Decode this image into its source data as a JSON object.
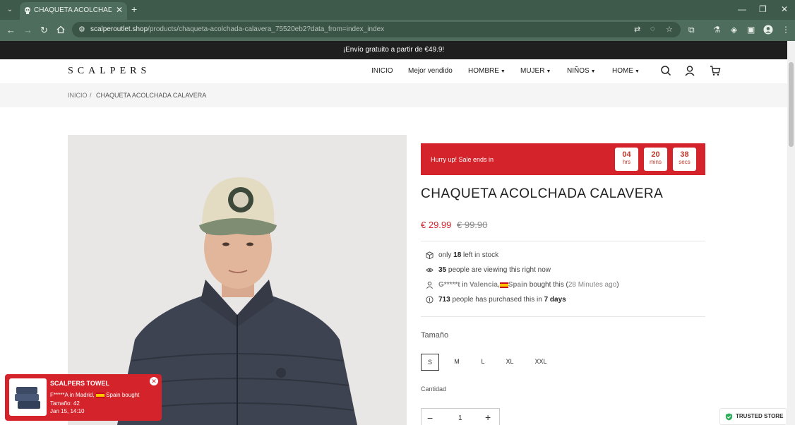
{
  "browser": {
    "tab_title": "CHAQUETA ACOLCHADA CALAVERA",
    "url_main": "scalperoutlet.shop",
    "url_path": "/products/chaqueta-acolchada-calavera_75520eb2?data_from=index_index",
    "new_tab": "+",
    "minimize": "—",
    "maximize": "❐",
    "close": "✕"
  },
  "promo_text": "¡Envío gratuito a partir de €49.9!",
  "header": {
    "logo": "SCALPERS",
    "menu": [
      {
        "label": "INICIO"
      },
      {
        "label": "Mejor vendido"
      },
      {
        "label": "HOMBRE"
      },
      {
        "label": "MUJER"
      },
      {
        "label": "NIÑOS"
      },
      {
        "label": "HOME"
      }
    ]
  },
  "breadcrumb": {
    "home": "INICIO",
    "separator": "/",
    "current": "CHAQUETA ACOLCHADA CALAVERA"
  },
  "sale": {
    "text": "Hurry up!  Sale ends in",
    "hours": "04",
    "hours_unit": "hrs",
    "mins": "20",
    "mins_unit": "mins",
    "secs": "38",
    "secs_unit": "secs"
  },
  "product": {
    "title": "CHAQUETA ACOLCHADA CALAVERA",
    "price": "€ 29.99",
    "old_price": "€ 99.90"
  },
  "info": {
    "stock_pre": "only",
    "stock_count": "18",
    "stock_post": "left in stock",
    "viewing_count": "35",
    "viewing_post": "people are viewing this right now",
    "buyer_name": "G*****t",
    "buyer_in": "in",
    "buyer_city": "Valencia,",
    "buyer_country": "Spain",
    "buyer_post": "bought this (",
    "buyer_time": "28 Minutes ago",
    "buyer_close": ")",
    "purchased_count": "713",
    "purchased_mid": "people has purchased this in",
    "purchased_days": "7 days"
  },
  "size_label": "Tamaño",
  "sizes": [
    "S",
    "M",
    "L",
    "XL",
    "XXL"
  ],
  "selected_size": "S",
  "qty_label": "Cantidad",
  "qty": {
    "minus": "−",
    "value": "1",
    "plus": "+"
  },
  "popup": {
    "title": "SCALPERS TOWEL",
    "line1_pre": "F*****A in Madrid,",
    "line1_post": "Spain bought",
    "line2": "Tamaño: 42",
    "line3": "Jan 15, 14:10",
    "close": "✕"
  },
  "trusted": "TRUSTED STORE",
  "colors": {
    "accent": "#d4232b",
    "dark": "#1f1f1f",
    "chrome": "#4f6d5c",
    "trusted": "#2eae5a"
  }
}
